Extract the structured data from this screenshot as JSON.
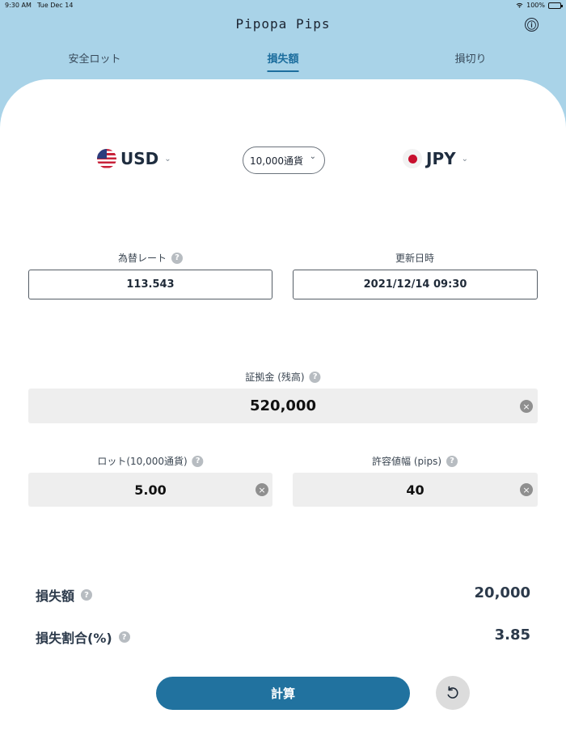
{
  "status": {
    "time": "9:30 AM",
    "date": "Tue Dec 14",
    "battery": "100%"
  },
  "app": {
    "title": "Pipopa Pips",
    "info_icon": "ⓘ"
  },
  "tabs": [
    {
      "label": "安全ロット",
      "active": false
    },
    {
      "label": "損失額",
      "active": true
    },
    {
      "label": "損切り",
      "active": false
    }
  ],
  "currency": {
    "base": {
      "code": "USD",
      "flag": "us-flag"
    },
    "quote": {
      "code": "JPY",
      "flag": "jp-flag"
    },
    "unit": "10,000通貨",
    "chevron": "⌄"
  },
  "rate": {
    "label": "為替レート",
    "value": "113.543"
  },
  "updated": {
    "label": "更新日時",
    "value": "2021/12/14 09:30"
  },
  "margin": {
    "label": "証拠金 (残高)",
    "value": "520,000"
  },
  "lot": {
    "label": "ロット(10,000通貨)",
    "value": "5.00"
  },
  "pips": {
    "label": "許容値幅 (pips)",
    "value": "40"
  },
  "results": {
    "loss_label": "損失額",
    "loss_value": "20,000",
    "ratio_label": "損失割合(%)",
    "ratio_value": "3.85"
  },
  "buttons": {
    "calculate": "計算",
    "help": "?",
    "clear": "×"
  },
  "colors": {
    "accent": "#21729f",
    "header_bg": "#a9d3e8"
  }
}
